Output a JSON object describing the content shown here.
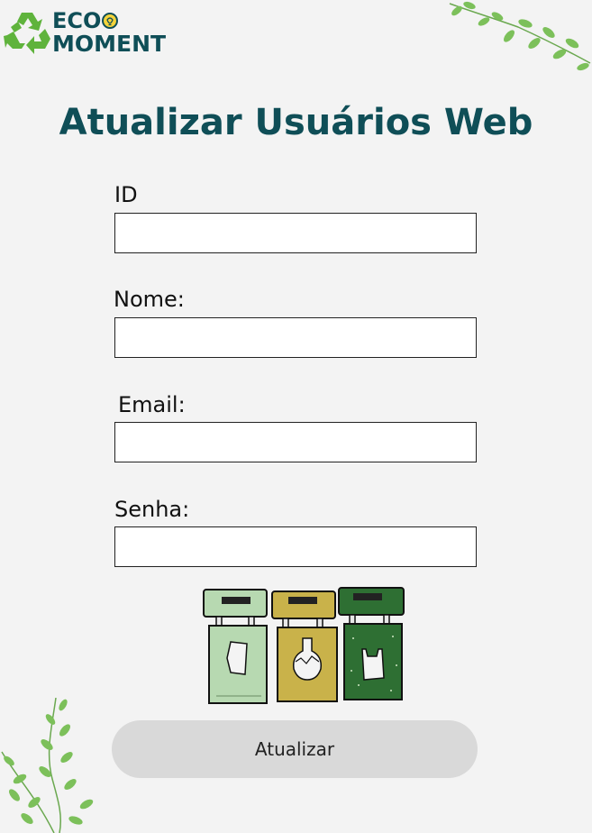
{
  "brand": {
    "line1": "ECO",
    "line2": "MOMENT",
    "color": "#0f4e57",
    "accent": "#5fb33c"
  },
  "page": {
    "title": "Atualizar Usuários Web",
    "background": "#f3f3f3"
  },
  "form": {
    "fields": [
      {
        "label": "ID",
        "value": ""
      },
      {
        "label": "Nome:",
        "value": ""
      },
      {
        "label": "Email:",
        "value": ""
      },
      {
        "label": "Senha:",
        "value": ""
      }
    ],
    "submit_label": "Atualizar"
  },
  "illustration": {
    "icon": "recycling-bins-icon",
    "bins": [
      "paper-bin",
      "glass-bin",
      "plastic-bin"
    ],
    "colors": [
      "#b7d9b1",
      "#c9b24a",
      "#2e6f33"
    ]
  },
  "decorations": [
    "vine-leaves-top-right",
    "vine-leaves-bottom-left"
  ]
}
